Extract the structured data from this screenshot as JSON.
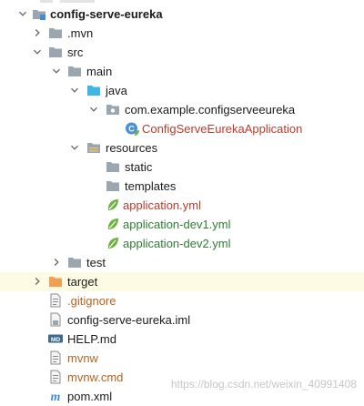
{
  "tree": {
    "root": "config-serve-eureka",
    "mvn": ".mvn",
    "src": "src",
    "main": "main",
    "java": "java",
    "package": "com.example.configserveeureka",
    "app_class": "ConfigServeEurekaApplication",
    "resources": "resources",
    "static": "static",
    "templates": "templates",
    "app_yml": "application.yml",
    "app_dev1": "application-dev1.yml",
    "app_dev2": "application-dev2.yml",
    "test": "test",
    "target": "target",
    "gitignore": ".gitignore",
    "iml": "config-serve-eureka.iml",
    "help": "HELP.md",
    "help_icon_text": "MD",
    "mvnw": "mvnw",
    "mvnw_cmd": "mvnw.cmd",
    "pom": "pom.xml",
    "pom_icon_text": "m",
    "class_icon_text": "C"
  },
  "watermark": "https://blog.csdn.net/weixin_40991408",
  "colors": {
    "folder": "#9aa7b0",
    "source_folder": "#40b6e0",
    "target_folder": "#f0a050",
    "spring_leaf": "#6db33f",
    "highlight_row": "#fdfbe3",
    "red_text": "#c0392b",
    "green_text": "#2e7d32"
  }
}
